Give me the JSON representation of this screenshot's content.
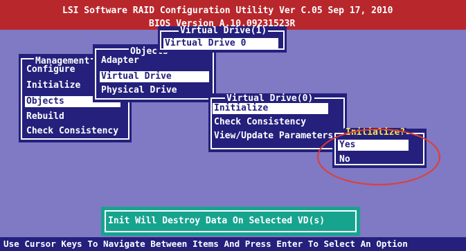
{
  "header": {
    "title": "LSI Software RAID Configuration Utility Ver C.05 Sep 17, 2010",
    "bios_version": "BIOS Version   A.10.09231523R"
  },
  "management": {
    "title": "Management",
    "items": [
      "Configure",
      "Initialize",
      "Objects",
      "Rebuild",
      "Check Consistency"
    ],
    "selected": "Objects"
  },
  "objects": {
    "title": "Objects",
    "items": [
      "Adapter",
      "Virtual Drive",
      "Physical Drive"
    ],
    "selected": "Virtual Drive"
  },
  "vd_list": {
    "title": "Virtual Drive(1)",
    "items": [
      "Virtual Drive 0"
    ],
    "selected": "Virtual Drive 0"
  },
  "vd0": {
    "title": "Virtual Drive(0)",
    "items": [
      "Initialize",
      "Check Consistency",
      "View/Update Parameters"
    ],
    "selected": "Initialize"
  },
  "initialize_confirm": {
    "title": "Initialize?",
    "options": [
      "Yes",
      "No"
    ],
    "selected": "Yes"
  },
  "message": "Init Will Destroy Data On Selected VD(s)",
  "status_bar": "Use Cursor Keys To Navigate Between Items And Press Enter To Select An Option",
  "colors": {
    "background": "#8079c4",
    "header": "#b8272c",
    "window": "#24207c",
    "message_box": "#17a48f",
    "highlight_oval": "#e53b2f"
  }
}
